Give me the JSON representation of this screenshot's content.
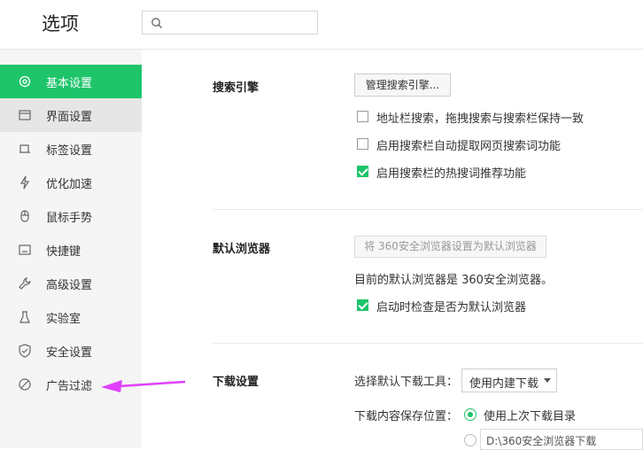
{
  "header": {
    "title": "选项",
    "search_placeholder": ""
  },
  "sidebar": {
    "items": [
      {
        "label": "基本设置",
        "icon": "gear-icon"
      },
      {
        "label": "界面设置",
        "icon": "window-icon"
      },
      {
        "label": "标签设置",
        "icon": "tab-icon"
      },
      {
        "label": "优化加速",
        "icon": "lightning-icon"
      },
      {
        "label": "鼠标手势",
        "icon": "mouse-icon"
      },
      {
        "label": "快捷键",
        "icon": "keyboard-icon"
      },
      {
        "label": "高级设置",
        "icon": "wrench-icon"
      },
      {
        "label": "实验室",
        "icon": "flask-icon"
      },
      {
        "label": "安全设置",
        "icon": "shield-icon"
      },
      {
        "label": "广告过滤",
        "icon": "block-icon"
      }
    ]
  },
  "search_engine": {
    "label": "搜索引擎",
    "manage_button": "管理搜索引擎...",
    "options": [
      {
        "text": "地址栏搜索，拖拽搜索与搜索栏保持一致",
        "checked": false
      },
      {
        "text": "启用搜索栏自动提取网页搜索词功能",
        "checked": false
      },
      {
        "text": "启用搜索栏的热搜词推荐功能",
        "checked": true
      }
    ]
  },
  "default_browser": {
    "label": "默认浏览器",
    "set_button": "将 360安全浏览器设置为默认浏览器",
    "status": "目前的默认浏览器是 360安全浏览器。",
    "check_option": {
      "text": "启动时检查是否为默认浏览器",
      "checked": true
    }
  },
  "download": {
    "label": "下载设置",
    "tool_label": "选择默认下载工具：",
    "tool_value": "使用内建下载",
    "location_label": "下载内容保存位置：",
    "location_option1": "使用上次下载目录",
    "path_value": "D:\\360安全浏览器下载"
  },
  "colors": {
    "accent": "#1ec46a",
    "sidebar_bg": "#f5f5f5",
    "arrow": "#e040fb"
  }
}
